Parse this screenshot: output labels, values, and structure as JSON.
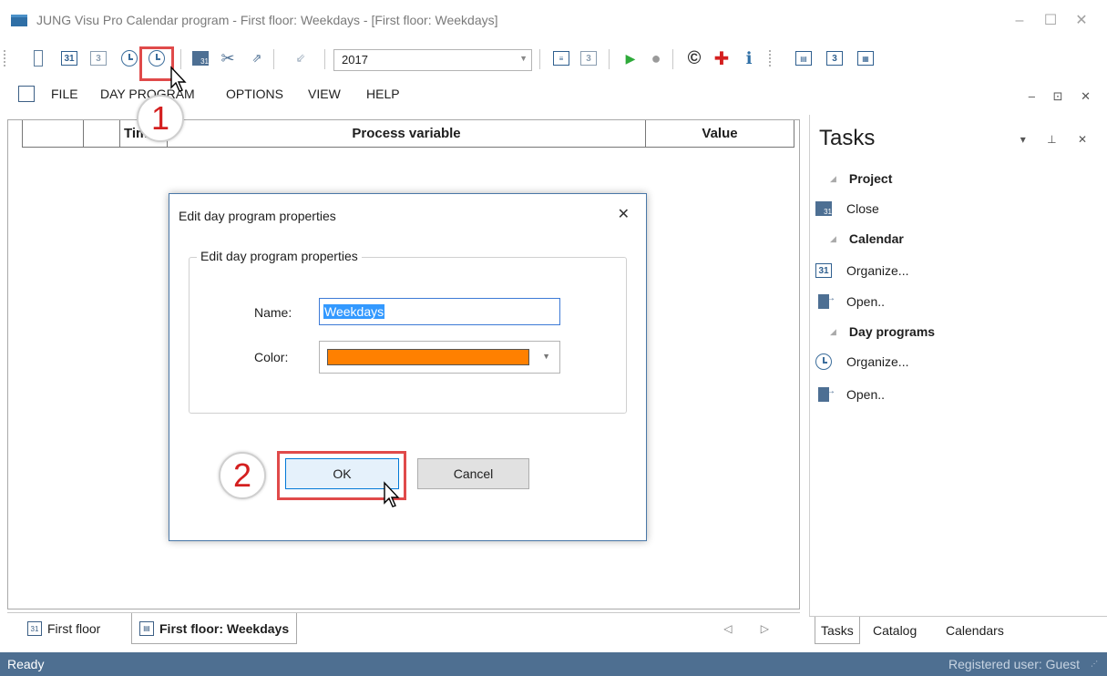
{
  "window": {
    "title": "JUNG Visu Pro Calendar program - First floor: Weekdays - [First floor: Weekdays]",
    "minimize": "–",
    "maximize": "☐",
    "close": "✕"
  },
  "toolbar": {
    "year": "2017"
  },
  "menu": {
    "items": [
      "FILE",
      "DAY PROGRAM",
      "OPTIONS",
      "VIEW",
      "HELP"
    ],
    "mdi_controls": "– ⊡ ✕"
  },
  "grid": {
    "columns": [
      "",
      "",
      "Time",
      "Process variable",
      "Value"
    ]
  },
  "doc_tabs": [
    {
      "label": "First floor",
      "active": false
    },
    {
      "label": "First floor: Weekdays",
      "active": true
    }
  ],
  "doc_tab_nav": "◁ ▷",
  "tasks": {
    "title": "Tasks",
    "controls": "▾ ⊥ ✕",
    "groups": [
      {
        "label": "Project",
        "items": [
          {
            "label": "Close",
            "icon": "close-project-icon"
          }
        ]
      },
      {
        "label": "Calendar",
        "items": [
          {
            "label": "Organize...",
            "icon": "calendar-icon"
          },
          {
            "label": "Open..",
            "icon": "open-icon"
          }
        ]
      },
      {
        "label": "Day programs",
        "items": [
          {
            "label": "Organize...",
            "icon": "clock-icon"
          },
          {
            "label": "Open..",
            "icon": "open-icon"
          }
        ]
      }
    ]
  },
  "right_tabs": [
    "Tasks",
    "Catalog",
    "Calendars"
  ],
  "status": {
    "left": "Ready",
    "right": "Registered user: Guest"
  },
  "dialog": {
    "title": "Edit day program properties",
    "group_title": "Edit day program properties",
    "name_label": "Name:",
    "name_value": "Weekdays",
    "color_label": "Color:",
    "color_value": "#ff8000",
    "ok_label": "OK",
    "cancel_label": "Cancel"
  },
  "callouts": [
    "1",
    "2"
  ]
}
